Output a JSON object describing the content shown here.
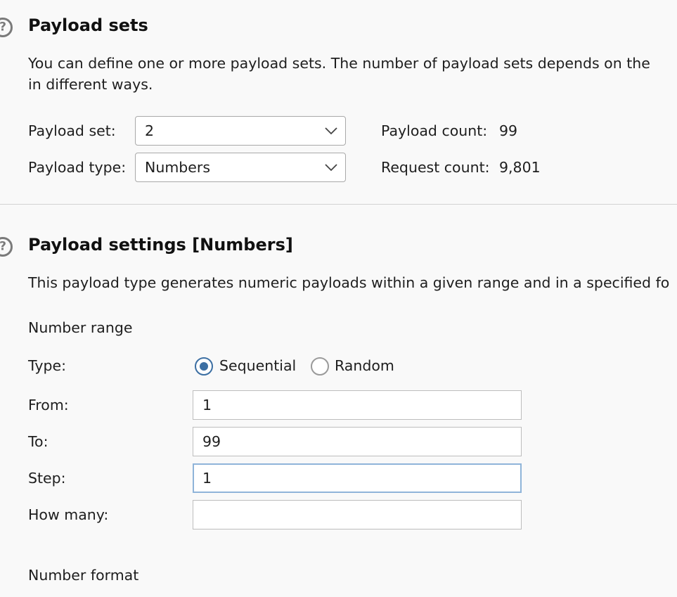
{
  "payload_sets": {
    "title": "Payload sets",
    "description_line1": "You can define one or more payload sets. The number of payload sets depends on the",
    "description_line2": "in different ways.",
    "payload_set_label": "Payload set:",
    "payload_set_value": "2",
    "payload_type_label": "Payload type:",
    "payload_type_value": "Numbers",
    "payload_count_label": "Payload count:",
    "payload_count_value": "99",
    "request_count_label": "Request count:",
    "request_count_value": "9,801"
  },
  "payload_settings": {
    "title": "Payload settings [Numbers]",
    "description": "This payload type generates numeric payloads within a given range and in a specified fo",
    "number_range_heading": "Number range",
    "type_label": "Type:",
    "type_options": [
      {
        "label": "Sequential",
        "selected": true
      },
      {
        "label": "Random",
        "selected": false
      }
    ],
    "from_label": "From:",
    "from_value": "1",
    "to_label": "To:",
    "to_value": "99",
    "step_label": "Step:",
    "step_value": "1",
    "how_many_label": "How many:",
    "how_many_value": "",
    "number_format_heading": "Number format"
  },
  "icons": {
    "help": "help-icon",
    "dropdown": "chevron-down-icon"
  },
  "colors": {
    "background": "#f9f9f9",
    "radio_accent": "#3c6fa3",
    "focus_border": "#8fb4d9",
    "divider": "#d3d3d3"
  }
}
